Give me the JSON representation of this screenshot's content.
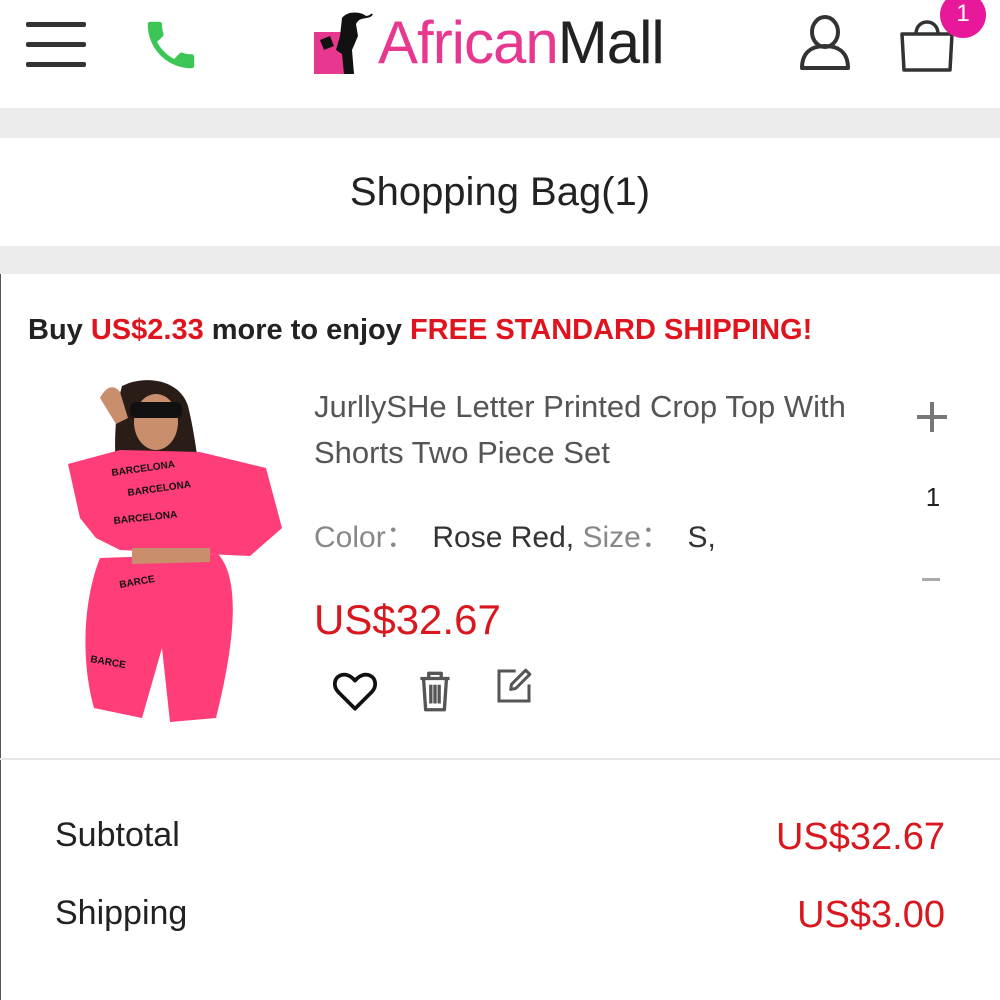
{
  "header": {
    "logo_part1": "African",
    "logo_part2": "Mall",
    "cart_count": "1",
    "icons": [
      "menu-icon",
      "phone-icon",
      "user-icon",
      "shopping-bag-icon"
    ]
  },
  "page_title": "Shopping Bag(1)",
  "promo": {
    "prefix": "Buy ",
    "amount": "US$2.33",
    "middle": " more to enjoy ",
    "offer": "FREE STANDARD SHIPPING!"
  },
  "item": {
    "title": "JurllySHe Letter Printed Crop Top With Shorts Two Piece Set",
    "color_label": "Color：",
    "color_value": "Rose Red",
    "size_label": "Size：",
    "size_value": "S",
    "price": "US$32.67",
    "quantity": "1",
    "image_prints": [
      "BARCELONA",
      "BARCELONA",
      "BARCE",
      "BARCELONA",
      "BARCE"
    ]
  },
  "summary": {
    "subtotal_label": "Subtotal",
    "subtotal_value": "US$32.67",
    "shipping_label": "Shipping",
    "shipping_value": "US$3.00"
  },
  "colors": {
    "brand_pink": "#e8378f",
    "price_red": "#d8171e",
    "promo_red": "#e0141e",
    "phone_green": "#3cc656",
    "badge_pink": "#e8189b"
  }
}
